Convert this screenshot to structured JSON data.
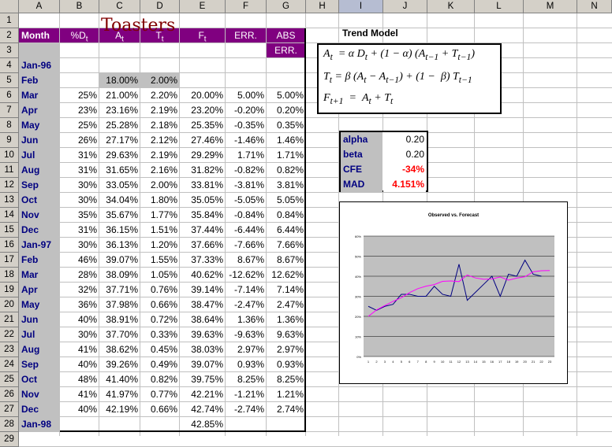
{
  "sheet": {
    "columns": [
      "A",
      "B",
      "C",
      "D",
      "E",
      "F",
      "G",
      "H",
      "I",
      "J",
      "K",
      "L",
      "M",
      "N"
    ],
    "selected_column": "I",
    "rows": [
      "1",
      "2",
      "3",
      "4",
      "5",
      "6",
      "7",
      "8",
      "9",
      "10",
      "11",
      "12",
      "13",
      "14",
      "15",
      "16",
      "17",
      "18",
      "19",
      "20",
      "21",
      "22",
      "23",
      "24",
      "25",
      "26",
      "27",
      "28",
      "29"
    ],
    "title": "Toasters",
    "headers": [
      "Month",
      "%D",
      "A",
      "T",
      "F",
      "ERR.",
      "ABS",
      "ERR."
    ],
    "header_subscript": "t",
    "data": [
      {
        "month": "Jan-96",
        "pd": "",
        "a": "",
        "t": "",
        "f": "",
        "err": "",
        "abs": ""
      },
      {
        "month": "Feb",
        "pd": "",
        "a": "18.00%",
        "t": "2.00%",
        "f": "",
        "err": "",
        "abs": ""
      },
      {
        "month": "Mar",
        "pd": "25%",
        "a": "21.00%",
        "t": "2.20%",
        "f": "20.00%",
        "err": "5.00%",
        "abs": "5.00%"
      },
      {
        "month": "Apr",
        "pd": "23%",
        "a": "23.16%",
        "t": "2.19%",
        "f": "23.20%",
        "err": "-0.20%",
        "abs": "0.20%"
      },
      {
        "month": "May",
        "pd": "25%",
        "a": "25.28%",
        "t": "2.18%",
        "f": "25.35%",
        "err": "-0.35%",
        "abs": "0.35%"
      },
      {
        "month": "Jun",
        "pd": "26%",
        "a": "27.17%",
        "t": "2.12%",
        "f": "27.46%",
        "err": "-1.46%",
        "abs": "1.46%"
      },
      {
        "month": "Jul",
        "pd": "31%",
        "a": "29.63%",
        "t": "2.19%",
        "f": "29.29%",
        "err": "1.71%",
        "abs": "1.71%"
      },
      {
        "month": "Aug",
        "pd": "31%",
        "a": "31.65%",
        "t": "2.16%",
        "f": "31.82%",
        "err": "-0.82%",
        "abs": "0.82%"
      },
      {
        "month": "Sep",
        "pd": "30%",
        "a": "33.05%",
        "t": "2.00%",
        "f": "33.81%",
        "err": "-3.81%",
        "abs": "3.81%"
      },
      {
        "month": "Oct",
        "pd": "30%",
        "a": "34.04%",
        "t": "1.80%",
        "f": "35.05%",
        "err": "-5.05%",
        "abs": "5.05%"
      },
      {
        "month": "Nov",
        "pd": "35%",
        "a": "35.67%",
        "t": "1.77%",
        "f": "35.84%",
        "err": "-0.84%",
        "abs": "0.84%"
      },
      {
        "month": "Dec",
        "pd": "31%",
        "a": "36.15%",
        "t": "1.51%",
        "f": "37.44%",
        "err": "-6.44%",
        "abs": "6.44%"
      },
      {
        "month": "Jan-97",
        "pd": "30%",
        "a": "36.13%",
        "t": "1.20%",
        "f": "37.66%",
        "err": "-7.66%",
        "abs": "7.66%"
      },
      {
        "month": "Feb",
        "pd": "46%",
        "a": "39.07%",
        "t": "1.55%",
        "f": "37.33%",
        "err": "8.67%",
        "abs": "8.67%"
      },
      {
        "month": "Mar",
        "pd": "28%",
        "a": "38.09%",
        "t": "1.05%",
        "f": "40.62%",
        "err": "-12.62%",
        "abs": "12.62%"
      },
      {
        "month": "Apr",
        "pd": "32%",
        "a": "37.71%",
        "t": "0.76%",
        "f": "39.14%",
        "err": "-7.14%",
        "abs": "7.14%"
      },
      {
        "month": "May",
        "pd": "36%",
        "a": "37.98%",
        "t": "0.66%",
        "f": "38.47%",
        "err": "-2.47%",
        "abs": "2.47%"
      },
      {
        "month": "Jun",
        "pd": "40%",
        "a": "38.91%",
        "t": "0.72%",
        "f": "38.64%",
        "err": "1.36%",
        "abs": "1.36%"
      },
      {
        "month": "Jul",
        "pd": "30%",
        "a": "37.70%",
        "t": "0.33%",
        "f": "39.63%",
        "err": "-9.63%",
        "abs": "9.63%"
      },
      {
        "month": "Aug",
        "pd": "41%",
        "a": "38.62%",
        "t": "0.45%",
        "f": "38.03%",
        "err": "2.97%",
        "abs": "2.97%"
      },
      {
        "month": "Sep",
        "pd": "40%",
        "a": "39.26%",
        "t": "0.49%",
        "f": "39.07%",
        "err": "0.93%",
        "abs": "0.93%"
      },
      {
        "month": "Oct",
        "pd": "48%",
        "a": "41.40%",
        "t": "0.82%",
        "f": "39.75%",
        "err": "8.25%",
        "abs": "8.25%"
      },
      {
        "month": "Nov",
        "pd": "41%",
        "a": "41.97%",
        "t": "0.77%",
        "f": "42.21%",
        "err": "-1.21%",
        "abs": "1.21%"
      },
      {
        "month": "Dec",
        "pd": "40%",
        "a": "42.19%",
        "t": "0.66%",
        "f": "42.74%",
        "err": "-2.74%",
        "abs": "2.74%"
      },
      {
        "month": "Jan-98",
        "pd": "",
        "a": "",
        "t": "",
        "f": "42.85%",
        "err": "",
        "abs": ""
      }
    ]
  },
  "trend_model": {
    "title": "Trend Model"
  },
  "params": [
    {
      "label": "alpha",
      "value": "0.20",
      "red": false
    },
    {
      "label": "beta",
      "value": "0.20",
      "red": false
    },
    {
      "label": "CFE",
      "value": "-34%",
      "red": true
    },
    {
      "label": "MAD",
      "value": "4.151%",
      "red": true
    }
  ],
  "chart_data": {
    "type": "line",
    "title": "Observed vs. Forecast",
    "x": [
      1,
      2,
      3,
      4,
      5,
      6,
      7,
      8,
      9,
      10,
      11,
      12,
      13,
      14,
      15,
      16,
      17,
      18,
      19,
      20,
      21,
      22,
      23
    ],
    "yticks": [
      "0%",
      "10%",
      "20%",
      "30%",
      "40%",
      "50%",
      "60%"
    ],
    "ylim": [
      0,
      60
    ],
    "series": [
      {
        "values": [
          25,
          23,
          25,
          26,
          31,
          31,
          30,
          30,
          35,
          31,
          30,
          46,
          28,
          32,
          36,
          40,
          30,
          41,
          40,
          48,
          41,
          40
        ],
        "color": "#000080"
      },
      {
        "values": [
          20,
          23.2,
          25.35,
          27.46,
          29.29,
          31.82,
          33.81,
          35.05,
          35.84,
          37.44,
          37.66,
          37.33,
          40.62,
          39.14,
          38.47,
          38.64,
          39.63,
          38.03,
          39.07,
          39.75,
          42.21,
          42.74,
          42.85
        ],
        "color": "#ff00ff"
      }
    ]
  }
}
